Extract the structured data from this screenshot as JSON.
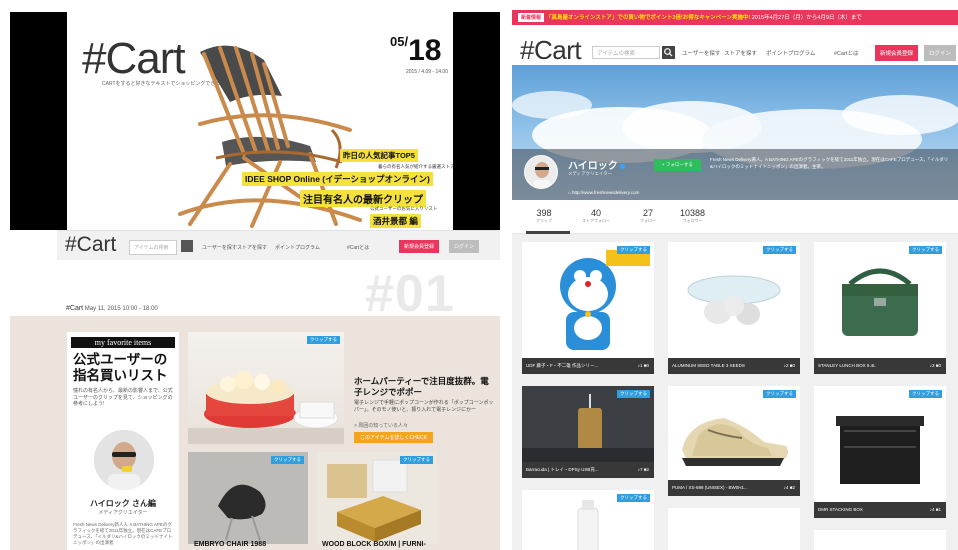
{
  "hero": {
    "logo": "#Cart",
    "logo_sub": "CARTをすると好きなテキストでショッピングできる",
    "date_month": "05/",
    "date_day": "18",
    "date_sub": "2015 / 4.09 - 14.00",
    "lines": [
      "昨日の人気記事TOP5",
      "IDEE SHOP Online (イデーショップオンライン)",
      "注目有名人の最新クリップ",
      "酒井景都 編"
    ],
    "notes": [
      "暮らの有名人気が紹介する厳選ストア",
      "公式ユーザーのお気に入りリスト"
    ]
  },
  "nav_left": {
    "logo": "#Cart",
    "search_placeholder": "アイテムの検索",
    "links": [
      "ユーザーを探す",
      "ストアを探す",
      "ポイントプログラム",
      "#Cartとは"
    ],
    "register": "新規会員登録",
    "login": "ログイン"
  },
  "issue": {
    "number": "#01",
    "crumb_logo": "#Cart",
    "crumb": "May 11, 2015 10:00 - 18:00"
  },
  "feature": {
    "tag": "my favorite items",
    "title": "公式ユーザーの指名買いリスト",
    "desc": "憧れの有名人から、最新の影響人まで、公式ユーザーのクリップを見て、ショッピングの参考にしよう!",
    "name": "ハイロック さん編",
    "role": "メディアクリエイター",
    "bio": "Fresh News Delivery新人人 A BATHING APEのグラフィックを経て2011年独立。現在はCAFEプロデュース、「イルダリ&ハイロックのミッドナイトニッポン」の出演者",
    "clip": "クリップする",
    "headline": "ホームパーティーで注目度抜群。電子レンジでポポー",
    "text": "電子レンジで手軽にポップコーンが作れる「ポップコーンポッパー」。そのモノ使いと、振り入れて電子レンジにかー",
    "link": "> 周囲の知っている人々",
    "btn": "このアイテムを詳しくCHECK",
    "cap1": "EMBRYO CHAIR 1988",
    "cap2": "WOOD BLOCK BOX/M | FURNI-"
  },
  "right": {
    "bar_badge": "新着情報",
    "bar_text": "「高島屋オンラインストア」での買い物でポイント3倍!お得なキャンペーン実施中!",
    "bar_date": " 2015年4月27日（月）から4月9日（木）まで",
    "logo": "#Cart",
    "search_placeholder": "アイテムの検索",
    "links": [
      "ユーザーを探す",
      "ストアを探す",
      "ポイントプログラム",
      "#Cartとは"
    ],
    "register": "新規会員登録",
    "login": "ログイン",
    "profile_name": "ハイロック",
    "profile_role": "メディアクリエイター",
    "follow": "+ フォローする",
    "bio": "Fresh News Delivery著人。A BATHING APEのグラフィックを経て2011年独立。現在はCAFEプロデュース、「イルダリ&ハイロックのミッドナイトニッポン」の出演者。主宰。",
    "url": "http://www.freshnewsdelivery.com",
    "stats": [
      {
        "n": "398",
        "l": "クリップ"
      },
      {
        "n": "40",
        "l": "ストアフォロー"
      },
      {
        "n": "27",
        "l": "フォロー"
      },
      {
        "n": "10388",
        "l": "フォロワー"
      }
    ],
    "clip": "クリップする",
    "cards": [
      {
        "cap": "UDF 藤子・F・不二雄 作品シリー...",
        "meta": "♪1 ■0"
      },
      {
        "cap": "ALUMINUM SEED TABLE 3 SEEDS",
        "meta": "♪2 ■0"
      },
      {
        "cap": "STANLEY LUNCH BOX 9.4L",
        "meta": "♪3 ■0"
      },
      {
        "cap": "Barracuda | トレイ・DPSy USB充...",
        "meta": "♪7 ■2"
      },
      {
        "cap": "PUMA / XS-698 (UNISEX) - BW0H1...",
        "meta": "♪4 ■2"
      },
      {
        "cap": "DMR STACKING BOX",
        "meta": "♪4 ■1"
      }
    ]
  }
}
